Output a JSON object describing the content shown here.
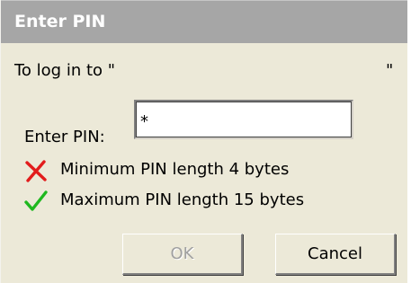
{
  "dialog": {
    "title": "Enter PIN",
    "login_prompt": "To log in to \"",
    "login_prompt_end": "\""
  },
  "pin": {
    "label": "Enter PIN:",
    "value": "*"
  },
  "rules": [
    {
      "icon": "x-mark-icon",
      "status": "unmet",
      "color": "#e21c1c",
      "text": "Minimum PIN length 4 bytes"
    },
    {
      "icon": "check-mark-icon",
      "status": "met",
      "color": "#1fb81f",
      "text": "Maximum PIN length 15 bytes"
    }
  ],
  "buttons": {
    "ok_label": "OK",
    "ok_enabled": false,
    "cancel_label": "Cancel"
  }
}
